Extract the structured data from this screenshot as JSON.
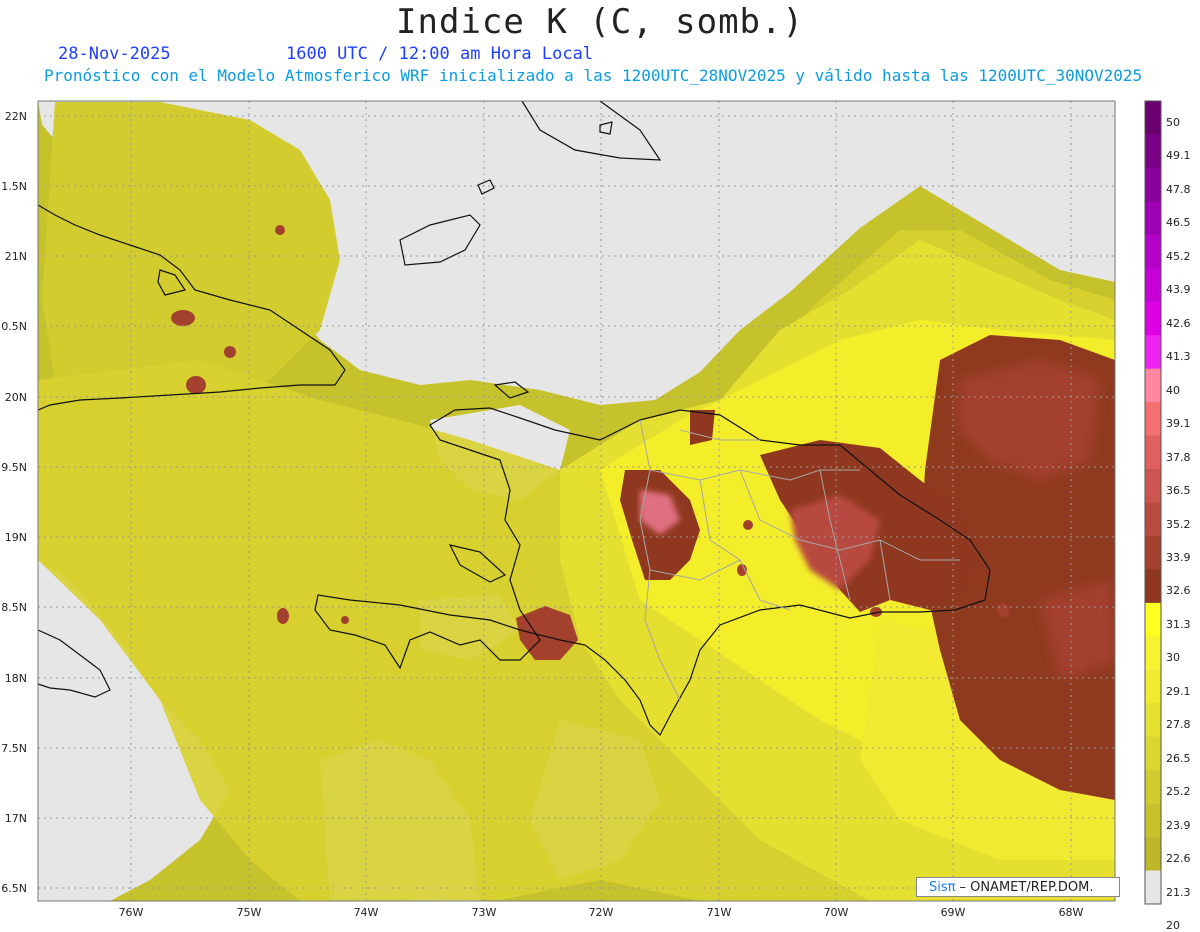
{
  "header": {
    "title": "Indice K (C, somb.)",
    "date": "28-Nov-2025",
    "time": "1600 UTC / 12:00 am Hora Local",
    "subtitle": "Pronóstico con el Modelo Atmosferico WRF inicializado a las 1200UTC_28NOV2025 y válido hasta las  1200UTC_30NOV2025"
  },
  "axes": {
    "latitudes": [
      "22N",
      "1.5N",
      "21N",
      "0.5N",
      "20N",
      "9.5N",
      "19N",
      "8.5N",
      "18N",
      "7.5N",
      "17N",
      "6.5N"
    ],
    "longitudes": [
      "76W",
      "75W",
      "74W",
      "73W",
      "72W",
      "71W",
      "70W",
      "69W",
      "68W"
    ]
  },
  "colorbar": {
    "levels": [
      "50",
      "49.1",
      "47.8",
      "46.5",
      "45.2",
      "43.9",
      "42.6",
      "41.3",
      "40",
      "39.1",
      "37.8",
      "36.5",
      "35.2",
      "33.9",
      "32.6",
      "31.3",
      "30",
      "29.1",
      "27.8",
      "26.5",
      "25.2",
      "23.9",
      "22.6",
      "21.3",
      "20"
    ],
    "colors": [
      "#6a0070",
      "#7a0085",
      "#8c00a0",
      "#a000b5",
      "#b400c8",
      "#c800d8",
      "#dd00e6",
      "#ee22f0",
      "#ff88a0",
      "#f47070",
      "#e06060",
      "#cc5550",
      "#b84a40",
      "#a4402e",
      "#90381f",
      "#ffff20",
      "#f8f330",
      "#f0ea30",
      "#e6e030",
      "#dcd630",
      "#d0cc2e",
      "#c6c22c",
      "#bcb82a",
      "#e6e6e6"
    ]
  },
  "credit": {
    "brand": "Sisπ",
    "text": "– ONAMET/REP.DOM."
  }
}
